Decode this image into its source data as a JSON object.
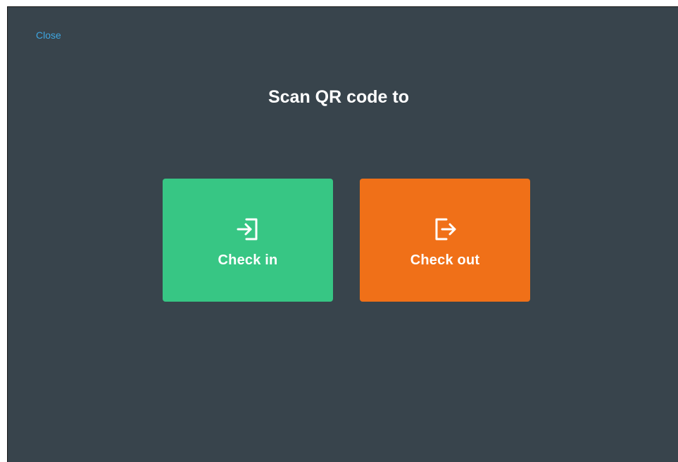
{
  "header": {
    "close_label": "Close",
    "title": "Scan QR code to"
  },
  "actions": {
    "check_in": {
      "label": "Check in",
      "icon": "check-in-icon",
      "color": "#37c684"
    },
    "check_out": {
      "label": "Check out",
      "icon": "check-out-icon",
      "color": "#f07018"
    }
  },
  "theme": {
    "background": "#38444c",
    "link": "#3ea6e0"
  }
}
